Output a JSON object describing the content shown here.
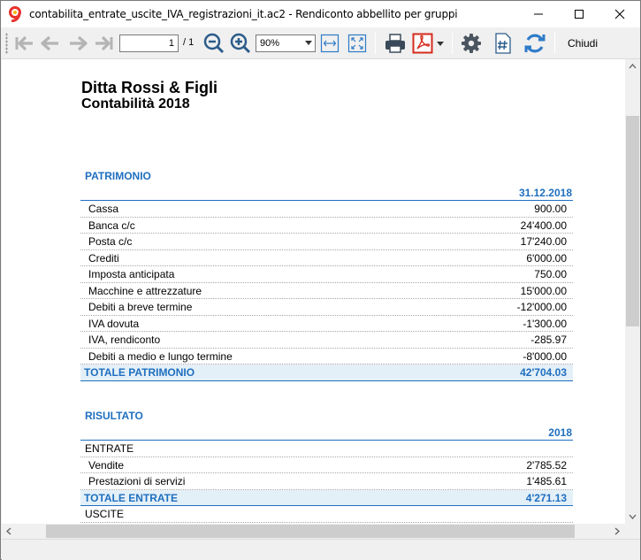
{
  "window": {
    "title": "contabilita_entrate_uscite_IVA_registrazioni_it.ac2 - Rendiconto abbellito per gruppi"
  },
  "toolbar": {
    "page_current": "1",
    "page_total": "/ 1",
    "zoom": "90%",
    "close_label": "Chiudi"
  },
  "document": {
    "company": "Ditta Rossi & Figli",
    "subtitle": "Contabilità 2018",
    "patrimonio": {
      "title": "PATRIMONIO",
      "column": "31.12.2018",
      "rows": [
        {
          "label": "Cassa",
          "value": "900.00"
        },
        {
          "label": "Banca c/c",
          "value": "24'400.00"
        },
        {
          "label": "Posta c/c",
          "value": "17'240.00"
        },
        {
          "label": "Crediti",
          "value": "6'000.00"
        },
        {
          "label": "Imposta anticipata",
          "value": "750.00"
        },
        {
          "label": "Macchine e attrezzature",
          "value": "15'000.00"
        },
        {
          "label": "Debiti a breve termine",
          "value": "-12'000.00"
        },
        {
          "label": "IVA dovuta",
          "value": "-1'300.00"
        },
        {
          "label": "IVA, rendiconto",
          "value": "-285.97"
        },
        {
          "label": "Debiti a medio e lungo termine",
          "value": "-8'000.00"
        }
      ],
      "total": {
        "label": "TOTALE PATRIMONIO",
        "value": "42'704.03"
      }
    },
    "risultato": {
      "title": "RISULTATO",
      "column": "2018",
      "entrate_label": "ENTRATE",
      "entrate_rows": [
        {
          "label": "Vendite",
          "value": "2'785.52"
        },
        {
          "label": "Prestazioni di servizi",
          "value": "1'485.61"
        }
      ],
      "entrate_total": {
        "label": "TOTALE ENTRATE",
        "value": "4'271.13"
      },
      "uscite_label": "USCITE"
    }
  },
  "colors": {
    "accent": "#1f6fbf",
    "total_bg": "#e4f0f8"
  }
}
